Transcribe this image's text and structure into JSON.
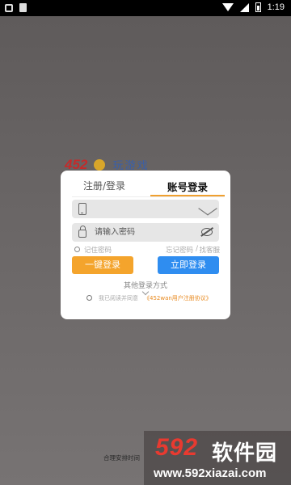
{
  "status_bar": {
    "time": "1:19",
    "icons": [
      "notification-icon",
      "sim-icon",
      "wifi-icon",
      "signal-icon",
      "battery-icon"
    ]
  },
  "background_logo": {
    "number": "452",
    "text": "玩游戏"
  },
  "login_dialog": {
    "tabs": [
      {
        "label": "注册/登录"
      },
      {
        "label": "账号登录",
        "selected": true
      }
    ],
    "account_field": {
      "value": "",
      "placeholder": ""
    },
    "password_field": {
      "value": "",
      "placeholder": "请输入密码"
    },
    "remember_password": "记住密码",
    "forgot_password": "忘记密码",
    "separator": "/",
    "find_service": "找客服",
    "one_click_login": "一键登录",
    "login_now": "立即登录",
    "other_login": "其他登录方式",
    "agreement_prefix": "我已阅读并同意",
    "agreement_link": "《452wan用户注册协议》"
  },
  "bottom_text": "合理安排时间",
  "watermark": {
    "brand_number": "592",
    "brand_text": "软件园",
    "url": "www.592xiazai.com"
  },
  "colors": {
    "accent_orange": "#f4a42c",
    "accent_blue": "#2f8df0",
    "link_orange": "#e88a20",
    "tab_underline": "#f0a030"
  }
}
